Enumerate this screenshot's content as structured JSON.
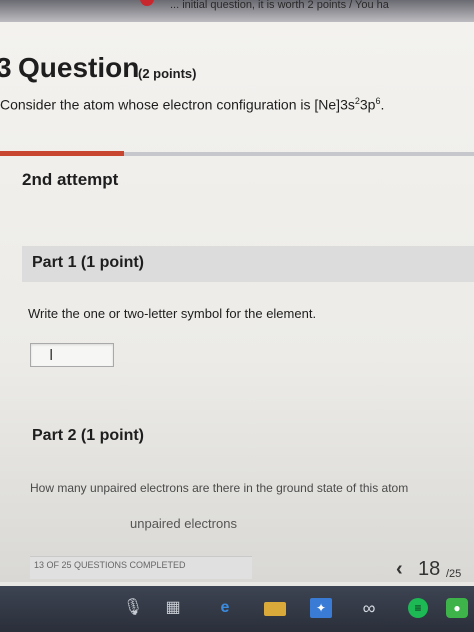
{
  "browser": {
    "title_fragment": "... initial question, it is worth 2 points / You ha"
  },
  "question": {
    "mark": "3",
    "title": "Question",
    "points": "(2 points)",
    "prompt_before": "Consider the atom whose electron configuration is [Ne]3s",
    "sup1": "2",
    "prompt_mid": "3p",
    "sup2": "6",
    "prompt_after": "."
  },
  "attempt": "2nd attempt",
  "part1": {
    "label": "Part 1   (1 point)",
    "instruction": "Write the one or two-letter symbol for the element.",
    "answer_value": "",
    "cursor": "I"
  },
  "part2": {
    "label": "Part 2   (1 point)",
    "question": "How many unpaired electrons are there in the ground state of this atom",
    "unit": "unpaired electrons"
  },
  "progress": {
    "text": "13 OF 25 QUESTIONS COMPLETED"
  },
  "pager": {
    "chevron": "‹",
    "current": "18",
    "total": "/25"
  },
  "taskbar": {
    "icons": [
      "microphone-icon",
      "task-view-icon",
      "edge-icon",
      "file-explorer-icon",
      "store-icon",
      "infinity-icon",
      "spotify-icon",
      "app-icon"
    ]
  },
  "colors": {
    "accent_red": "#c8462f",
    "rule_gray": "#c6c7cc",
    "band_gray": "#dcdcdc",
    "taskbar": "#2f3541"
  }
}
